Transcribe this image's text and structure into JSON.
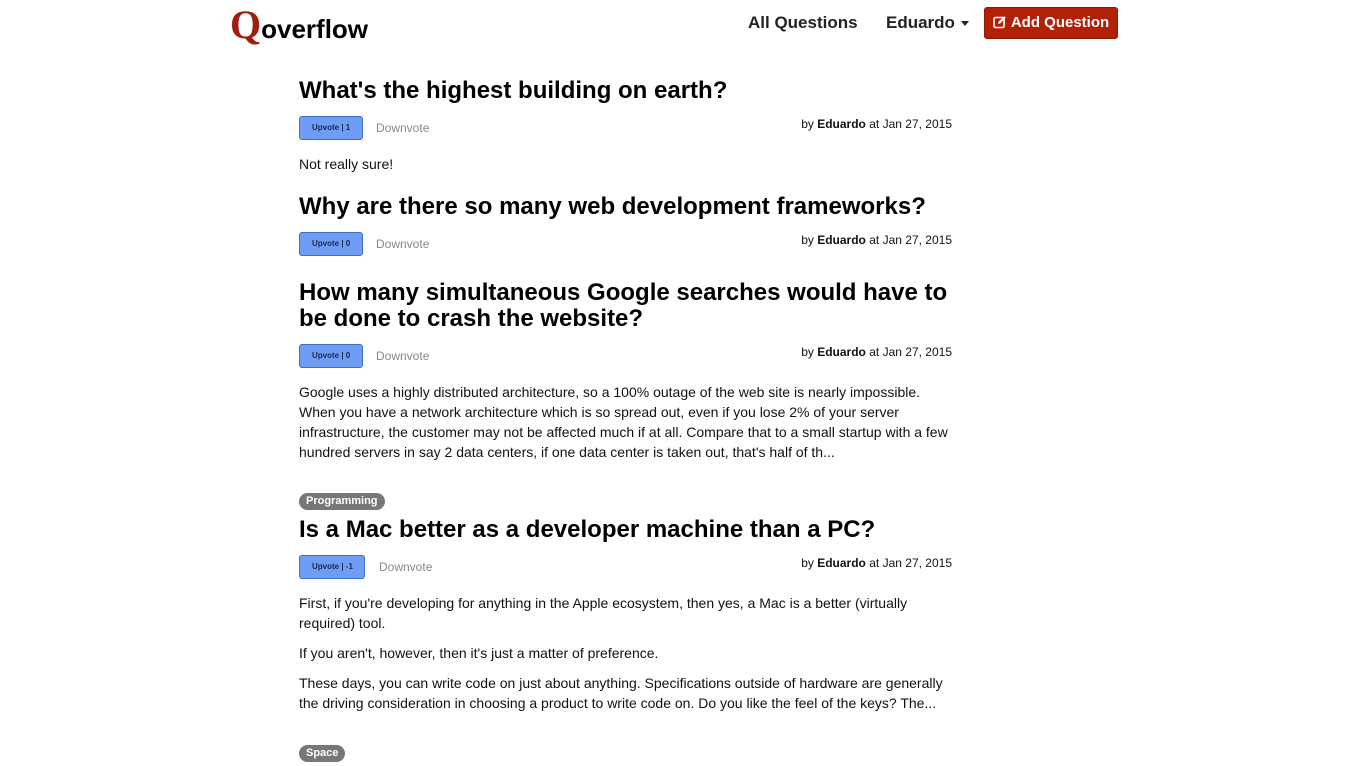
{
  "nav": {
    "brand_q": "Q",
    "brand_rest": "overflow",
    "all_questions": "All Questions",
    "user": "Eduardo",
    "add_question": "Add Question"
  },
  "colors": {
    "brand": "#a01e10",
    "add_button": "#b32008",
    "upvote": "#6f9cf5",
    "tag": "#777777"
  },
  "labels": {
    "downvote": "Downvote",
    "by": "by",
    "at": "at"
  },
  "questions": [
    {
      "title": "What's the highest building on earth?",
      "upvote": "Upvote | 1",
      "author": "Eduardo",
      "date": "Jan 27, 2015",
      "body": [
        "Not really sure!"
      ]
    },
    {
      "title": "Why are there so many web development frameworks?",
      "upvote": "Upvote | 0",
      "author": "Eduardo",
      "date": "Jan 27, 2015",
      "body": []
    },
    {
      "title": "How many simultaneous Google searches would have to be done to crash the website?",
      "upvote": "Upvote | 0",
      "author": "Eduardo",
      "date": "Jan 27, 2015",
      "body": [
        "Google uses a highly distributed architecture, so a 100% outage of the web site is nearly impossible. When you have a network architecture which is so spread out, even if you lose 2% of your server infrastructure, the customer may not be affected much if at all. Compare that to a small startup with a few hundred servers in say 2 data centers, if one data center is taken out, that's half of th..."
      ]
    },
    {
      "tag": "Programming",
      "title": "Is a Mac better as a developer machine than a PC?",
      "upvote": "Upvote | -1",
      "author": "Eduardo",
      "date": "Jan 27, 2015",
      "body": [
        "First, if you're developing for anything in the Apple ecosystem, then yes, a Mac is a better (virtually required) tool.",
        "If you aren't, however, then it's just a matter of preference.",
        "These days, you can write code on just about anything. Specifications outside of hardware are generally the driving consideration in choosing a product to write code on. Do you like the feel of the keys? The..."
      ]
    },
    {
      "tag": "Space"
    }
  ]
}
